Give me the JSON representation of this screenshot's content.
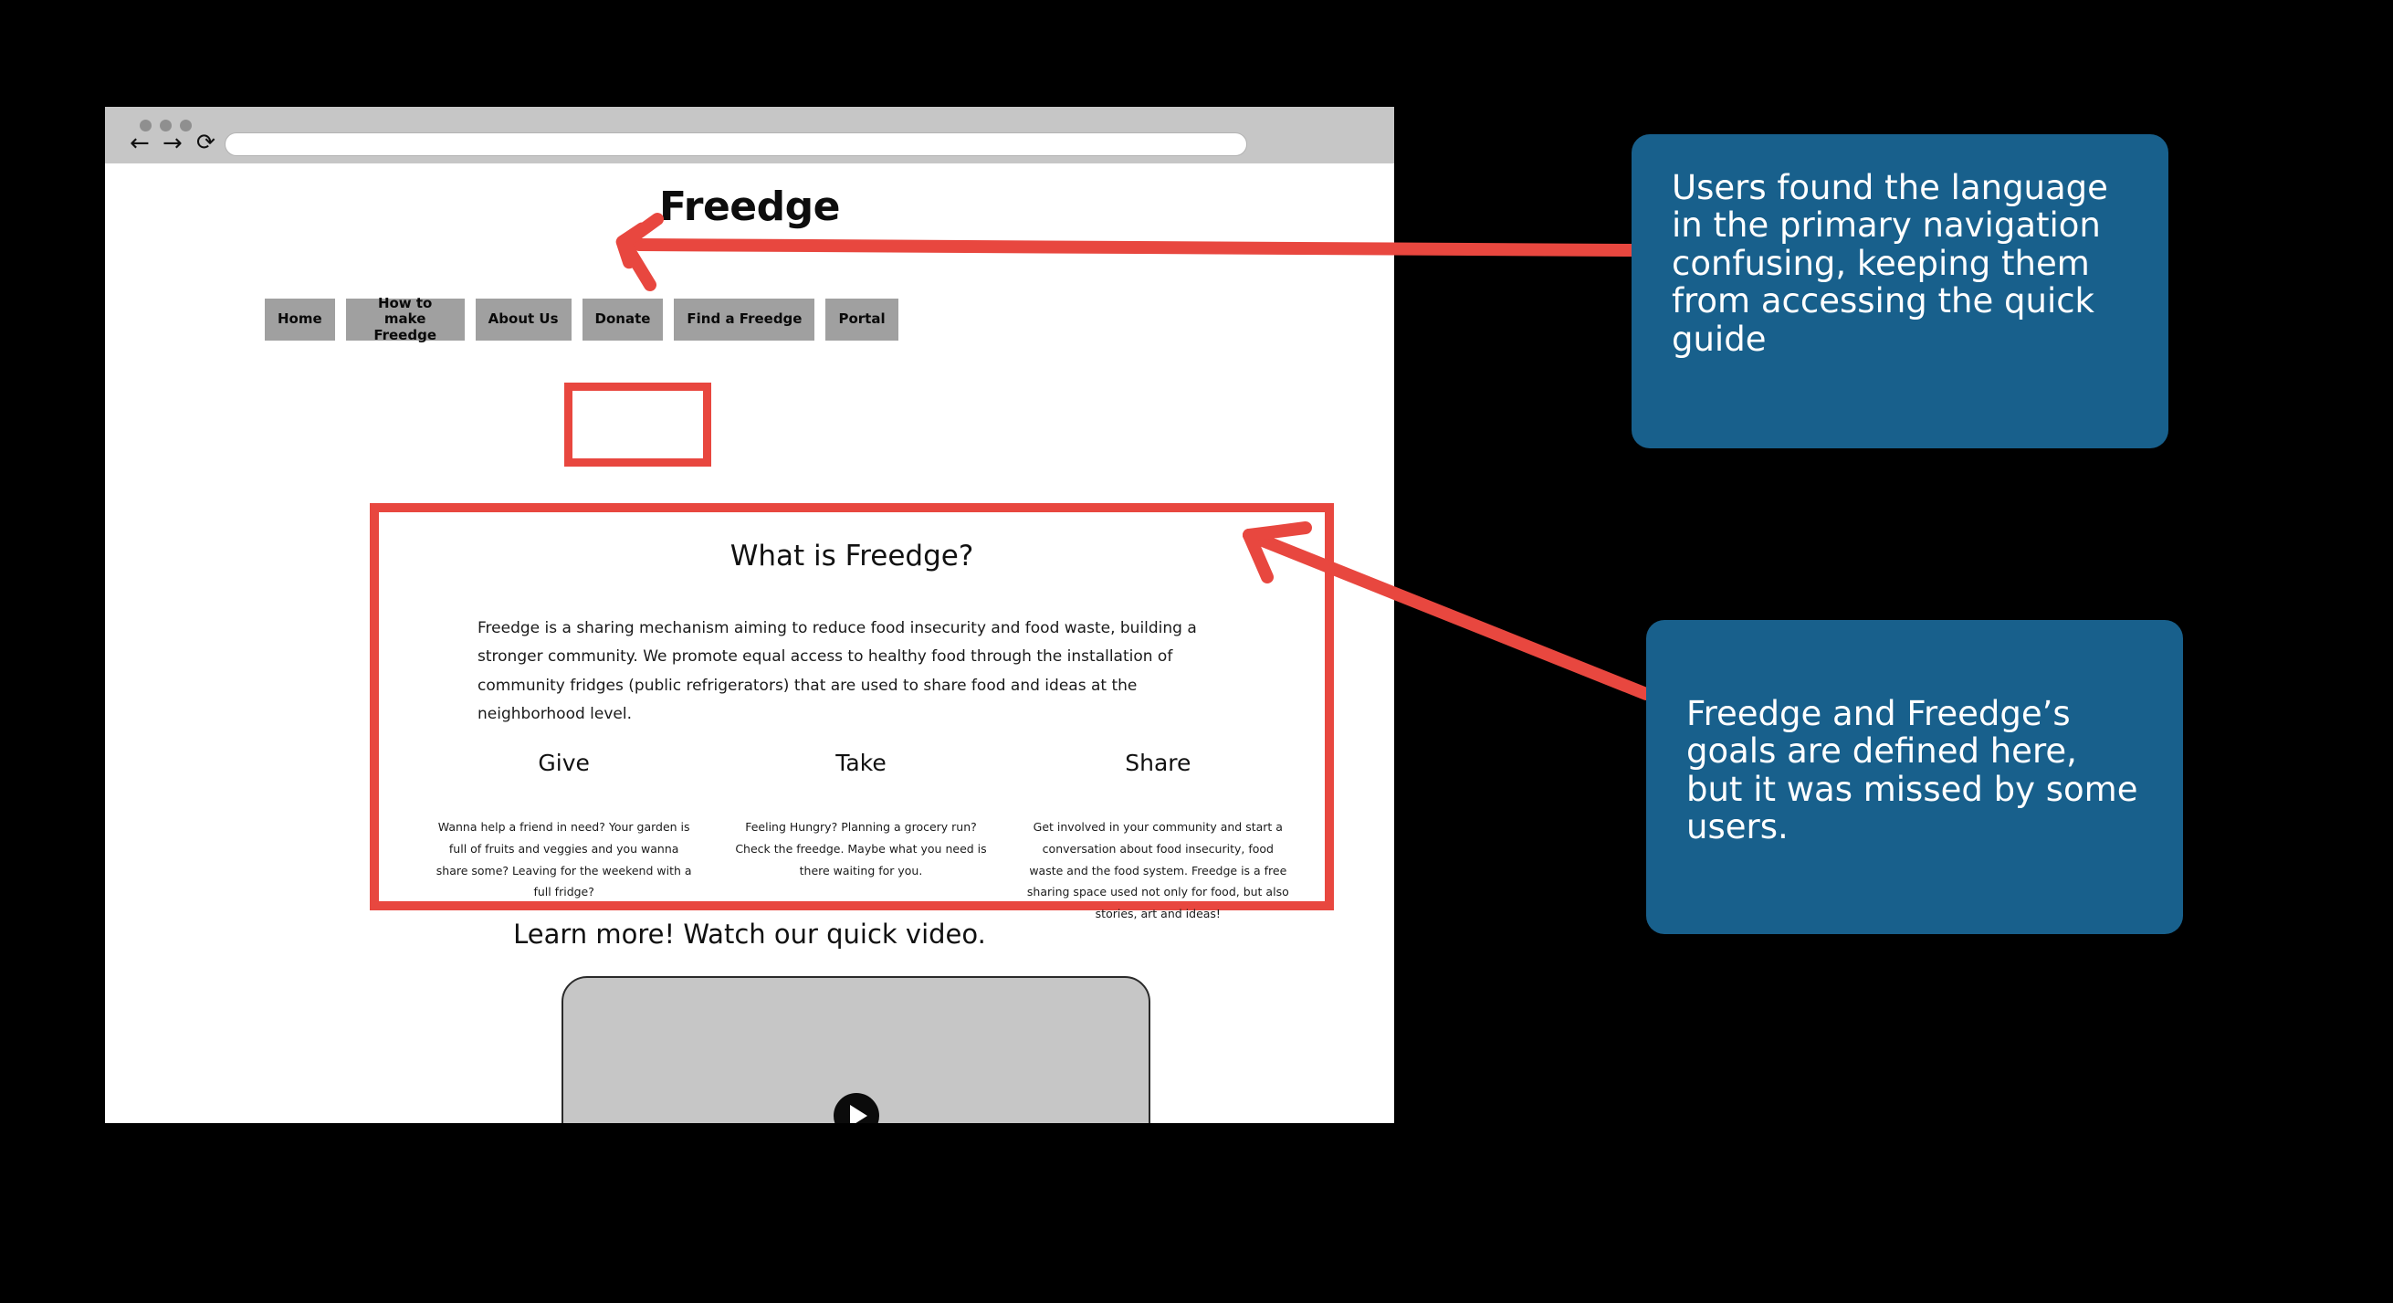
{
  "browser": {
    "window_dots": [
      "dot",
      "dot",
      "dot"
    ],
    "back_label": "←",
    "forward_label": "→",
    "reload_label": "⟳",
    "url_value": "",
    "url_placeholder": ""
  },
  "site": {
    "title": "Freedge",
    "nav": [
      {
        "label": "Home",
        "highlighted": false
      },
      {
        "label": "How to make Freedge",
        "highlighted": true
      },
      {
        "label": "About Us",
        "highlighted": false
      },
      {
        "label": "Donate",
        "highlighted": false
      },
      {
        "label": "Find a Freedge",
        "highlighted": false
      },
      {
        "label": "Portal",
        "highlighted": false
      }
    ]
  },
  "what_section": {
    "heading": "What is Freedge?",
    "paragraph": "Freedge is a sharing mechanism aiming to reduce food insecurity and food waste, building a stronger community. We promote equal access to healthy food through the installation of community fridges (public refrigerators) that are used to share food and ideas at the neighborhood level.",
    "columns": [
      {
        "heading": "Give",
        "body": "Wanna help a friend in need? Your garden is full of fruits and veggies and you wanna share some? Leaving for the weekend with a full fridge?"
      },
      {
        "heading": "Take",
        "body": "Feeling Hungry? Planning a grocery run? Check the freedge. Maybe what you need is there waiting for you."
      },
      {
        "heading": "Share",
        "body": "Get involved in your community and start a conversation about food insecurity, food waste and the food system. Freedge is a free sharing space used not only for food, but also stories, art and ideas!"
      }
    ]
  },
  "video_section": {
    "heading": "Learn more! Watch our quick video.",
    "play_icon": "play-icon"
  },
  "annotations": [
    {
      "id": "callout-navigation",
      "text": "Users found the language in the primary navigation confusing, keeping them from accessing the quick guide"
    },
    {
      "id": "callout-goals",
      "text": "Freedge and Freedge’s goals are defined here, but it was missed by some users."
    }
  ],
  "colors": {
    "annotation_blue": "#18608c",
    "highlight_red": "#e8473f",
    "nav_button_grey": "#a0a0a0",
    "chrome_grey": "#c6c6c6",
    "video_grey": "#c6c6c6",
    "background": "#000000"
  }
}
